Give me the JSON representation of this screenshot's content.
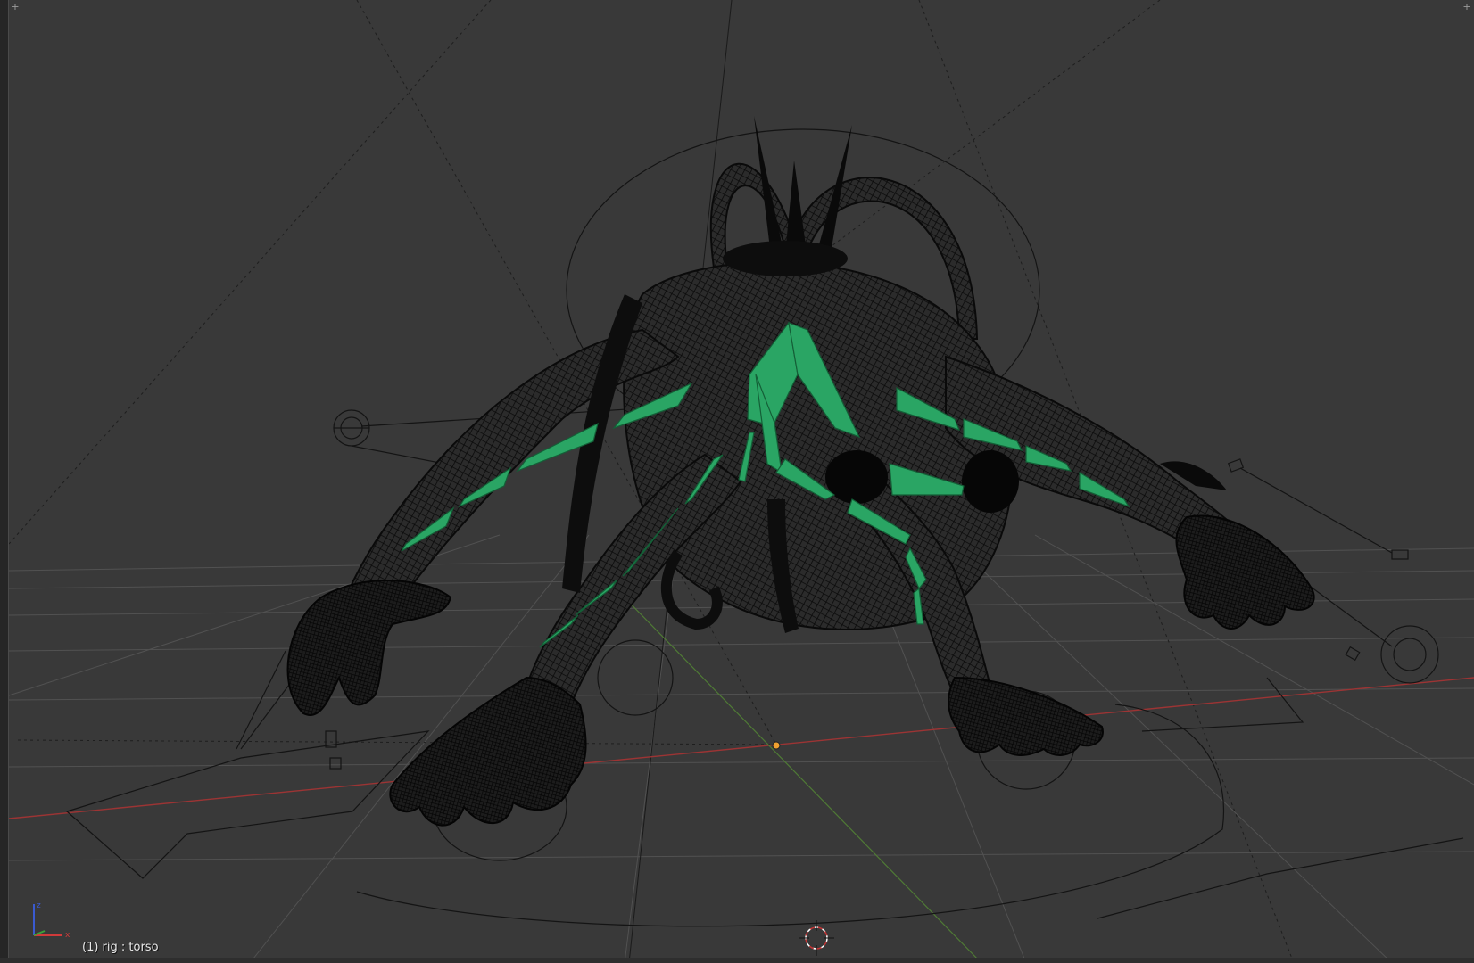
{
  "viewport": {
    "object_info": "(1) rig : torso",
    "axis_labels": {
      "x": "x",
      "y": "y",
      "z": "z"
    },
    "corner_left_icon": "viewport-split-icon",
    "corner_right_icon": "viewport-split-icon",
    "corner_glyph": "+"
  },
  "colors": {
    "background": "#393939",
    "grid": "#555555",
    "x_axis": "#9c3434",
    "y_axis": "#5a8a3a",
    "mesh_wire": "#0e0e0e",
    "bone": "#2aa564",
    "bone_edge": "#145f37"
  }
}
